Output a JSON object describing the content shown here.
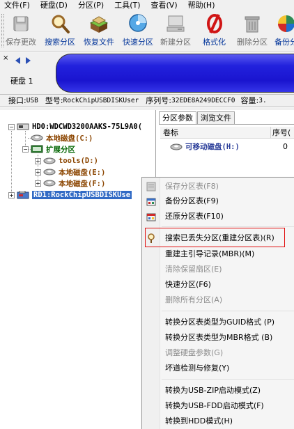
{
  "menubar": {
    "items": [
      "文件(F)",
      "硬盘(D)",
      "分区(P)",
      "工具(T)",
      "查看(V)",
      "帮助(H)"
    ]
  },
  "toolbar": {
    "buttons": [
      {
        "label": "保存更改",
        "icon": "save-icon",
        "state": "disabled"
      },
      {
        "label": "搜索分区",
        "icon": "magnifier-icon",
        "state": "active"
      },
      {
        "label": "恢复文件",
        "icon": "recover-files-icon",
        "state": "active"
      },
      {
        "label": "快速分区",
        "icon": "quick-partition-icon",
        "state": "active"
      },
      {
        "label": "新建分区",
        "icon": "new-partition-icon",
        "state": "disabled"
      },
      {
        "label": "格式化",
        "icon": "format-icon",
        "state": "active"
      },
      {
        "label": "删除分区",
        "icon": "delete-partition-icon",
        "state": "disabled"
      },
      {
        "label": "备份分",
        "icon": "backup-icon",
        "state": "active"
      }
    ]
  },
  "disk_strip": {
    "close_glyph": "×",
    "disk_label": "硬盘 1"
  },
  "info_line": {
    "iface_label": "接口:",
    "iface_value": "USB",
    "model_label": "型号:",
    "model_value": "RockChipUSBDISKUser",
    "serial_label": "序列号:",
    "serial_value": "32EDE8A249DECCF0",
    "capacity_label": "容量:",
    "capacity_value": "3."
  },
  "tree": {
    "hd0": "HD0:WDCWD3200AAKS-75L9A0(",
    "local_c": "本地磁盘(C:)",
    "extended": "扩展分区",
    "tools_d": "tools(D:)",
    "local_e": "本地磁盘(E:)",
    "local_f": "本地磁盘(F:)",
    "rd1": "RD1:RockChipUSBDISKUse"
  },
  "right_pane": {
    "tabs": [
      "分区参数",
      "浏览文件"
    ],
    "col_label": "卷标",
    "col_seq": "序号(",
    "row_name": "可移动磁盘(H:)",
    "row_seq": "0"
  },
  "context_menu": {
    "items": [
      {
        "label": "保存分区表(F8)",
        "disabled": true,
        "icon": "save-table-icon"
      },
      {
        "label": "备份分区表(F9)",
        "disabled": false,
        "icon": "backup-table-icon"
      },
      {
        "label": "还原分区表(F10)",
        "disabled": false,
        "icon": "restore-table-icon"
      },
      {
        "label": "搜索已丢失分区(重建分区表)(R)",
        "disabled": false,
        "icon": "search-lost-icon"
      },
      {
        "label": "重建主引导记录(MBR)(M)",
        "disabled": false,
        "icon": ""
      },
      {
        "label": "清除保留扇区(E)",
        "disabled": true,
        "icon": ""
      },
      {
        "label": "快速分区(F6)",
        "disabled": false,
        "icon": ""
      },
      {
        "label": "删除所有分区(A)",
        "disabled": true,
        "icon": ""
      },
      {
        "label": "转换分区表类型为GUID格式 (P)",
        "disabled": false,
        "icon": ""
      },
      {
        "label": "转换分区表类型为MBR格式 (B)",
        "disabled": false,
        "icon": ""
      },
      {
        "label": "调整硬盘参数(G)",
        "disabled": true,
        "icon": ""
      },
      {
        "label": "坏道检测与修复(Y)",
        "disabled": false,
        "icon": ""
      },
      {
        "label": "转换为USB-ZIP启动模式(Z)",
        "disabled": false,
        "icon": ""
      },
      {
        "label": "转换为USB-FDD启动模式(F)",
        "disabled": false,
        "icon": ""
      },
      {
        "label": "转换到HDD模式(H)",
        "disabled": false,
        "icon": ""
      }
    ]
  },
  "colors": {
    "disk_bar": "#1a14cf",
    "selection": "#316ac5",
    "local_disk_text": "#8b4500",
    "extended_text": "#006400",
    "highlight_border": "#e01010"
  }
}
